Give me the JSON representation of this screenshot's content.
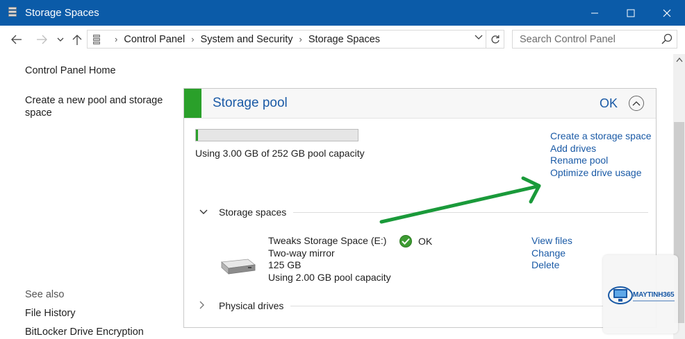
{
  "window": {
    "title": "Storage Spaces",
    "controls": {
      "minimize": "minimize-icon",
      "maximize": "maximize-icon",
      "close": "close-icon"
    }
  },
  "address_bar": {
    "breadcrumbs": [
      "Control Panel",
      "System and Security",
      "Storage Spaces"
    ],
    "search_placeholder": "Search Control Panel"
  },
  "sidebar": {
    "home": "Control Panel Home",
    "create_pool": "Create a new pool and storage space",
    "see_also": "See also",
    "see_also_links": [
      "File History",
      "BitLocker Drive Encryption"
    ]
  },
  "pool": {
    "title": "Storage pool",
    "status": "OK",
    "usage_text": "Using 3.00 GB of 252 GB pool capacity",
    "usage_fraction": 0.012,
    "links": [
      "Create a storage space",
      "Add drives",
      "Rename pool",
      "Optimize drive usage"
    ],
    "accent_color": "#2aa02a"
  },
  "storage_spaces": {
    "header": "Storage spaces",
    "items": [
      {
        "name": "Tweaks Storage Space (E:)",
        "resiliency": "Two-way mirror",
        "size": "125 GB",
        "usage": "Using 2.00 GB pool capacity",
        "status": "OK",
        "links": [
          "View files",
          "Change",
          "Delete"
        ]
      }
    ]
  },
  "physical_drives": {
    "header": "Physical drives"
  },
  "watermark": {
    "brand": "MAYTINH365"
  }
}
